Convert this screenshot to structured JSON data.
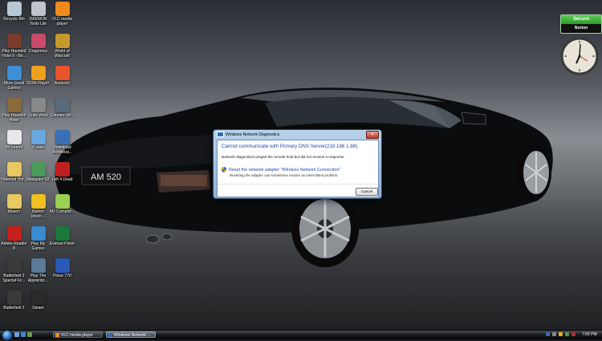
{
  "desktop": {
    "icons": [
      {
        "label": "Recycle Bin",
        "name": "recycle-bin-icon",
        "col": 0,
        "row": 0,
        "color": "#b8c7d6"
      },
      {
        "label": "DAEMON Tools Lite",
        "name": "daemon-tools-icon",
        "col": 1,
        "row": 0,
        "color": "#c0c4c8"
      },
      {
        "label": "VLC media player",
        "name": "vlc-icon",
        "col": 2,
        "row": 0,
        "color": "#f08a1c"
      },
      {
        "label": "Play Haunted Hotel II - Be...",
        "name": "haunted-hotel-2-icon",
        "col": 0,
        "row": 1,
        "color": "#7a3b2a"
      },
      {
        "label": "Dragonica",
        "name": "dragonica-icon",
        "col": 1,
        "row": 1,
        "color": "#c94a6a"
      },
      {
        "label": "World of Warcraft",
        "name": "wow-icon",
        "col": 2,
        "row": 1,
        "color": "#c49a2a"
      },
      {
        "label": "More Great Games",
        "name": "more-games-icon",
        "col": 0,
        "row": 2,
        "color": "#3d8fd6"
      },
      {
        "label": "GOM Player",
        "name": "gom-player-icon",
        "col": 1,
        "row": 2,
        "color": "#f0a020"
      },
      {
        "label": "Audacity",
        "name": "audacity-icon",
        "col": 2,
        "row": 2,
        "color": "#e8552a"
      },
      {
        "label": "Play Haunted Hotel",
        "name": "haunted-hotel-icon",
        "col": 0,
        "row": 3,
        "color": "#8a6a3a"
      },
      {
        "label": "Guild Wars",
        "name": "guild-wars-icon",
        "col": 1,
        "row": 3,
        "color": "#888888"
      },
      {
        "label": "Counter-Str...",
        "name": "counter-strike-icon",
        "col": 2,
        "row": 3,
        "color": "#5a6a7a"
      },
      {
        "label": "BitTorrent",
        "name": "bittorrent-icon",
        "col": 0,
        "row": 4,
        "color": "#e8e8e8"
      },
      {
        "label": "iTunes",
        "name": "itunes-icon",
        "col": 1,
        "row": 4,
        "color": "#6aa8e0"
      },
      {
        "label": "Download Accelerat...",
        "name": "download-accelerator-icon",
        "col": 2,
        "row": 4,
        "color": "#3a6fb8"
      },
      {
        "label": "Haunted Hot...",
        "name": "haunted-hotel-folder-icon",
        "col": 0,
        "row": 5,
        "color": "#e8c860"
      },
      {
        "label": "Navigator 52",
        "name": "navigator-icon",
        "col": 1,
        "row": 5,
        "color": "#4a9a5a"
      },
      {
        "label": "Left 4 Dead",
        "name": "left-4-dead-icon",
        "col": 2,
        "row": 5,
        "color": "#c02020"
      },
      {
        "label": "Mason",
        "name": "mason-folder-icon",
        "col": 0,
        "row": 6,
        "color": "#e8c860"
      },
      {
        "label": "Norton Intern...",
        "name": "norton-internet-icon",
        "col": 1,
        "row": 6,
        "color": "#f0c020"
      },
      {
        "label": "My Complet...",
        "name": "my-complete-folder-icon",
        "col": 2,
        "row": 6,
        "color": "#9ad050"
      },
      {
        "label": "Adobe Reader 8",
        "name": "adobe-reader-icon",
        "col": 0,
        "row": 7,
        "color": "#c8201a"
      },
      {
        "label": "Play My Games",
        "name": "play-my-games-icon",
        "col": 1,
        "row": 7,
        "color": "#3a8ad0"
      },
      {
        "label": "Everest Poker",
        "name": "everest-poker-icon",
        "col": 2,
        "row": 7,
        "color": "#1a7a3a"
      },
      {
        "label": "Battlefield 2 Special Fo...",
        "name": "battlefield-2-sf-icon",
        "col": 0,
        "row": 8,
        "color": "#3a3a3a"
      },
      {
        "label": "Play The Apprentic...",
        "name": "apprentice-icon",
        "col": 1,
        "row": 8,
        "color": "#5a7a9a"
      },
      {
        "label": "Poker 770",
        "name": "poker-770-icon",
        "col": 2,
        "row": 8,
        "color": "#2a5ab8"
      },
      {
        "label": "Battlefield 2",
        "name": "battlefield-2-icon",
        "col": 0,
        "row": 9,
        "color": "#3a3a3a"
      },
      {
        "label": "Steam",
        "name": "steam-icon",
        "col": 1,
        "row": 9,
        "color": "#2a2a2a"
      }
    ],
    "plate": "AM 520"
  },
  "norton": {
    "status": "Secure",
    "brand": "Norton"
  },
  "dialog": {
    "title": "Windows Network Diagnostics",
    "close": "×",
    "headline": "Cannot communicate with Primary DNS Server(218.186.1.88).",
    "detail": "Network diagnostics pinged the remote host but did not receive a response.",
    "option": "Reset the network adapter \"Wireless Network Connection\"",
    "option_desc": "Resetting the adapter can sometimes resolve an intermittent problem.",
    "cancel": "Cancel"
  },
  "taskbar": {
    "buttons": [
      {
        "label": "VLC media player",
        "color": "#f08a1c",
        "active": false
      },
      {
        "label": "Windows Network ...",
        "color": "#2c6fb8",
        "active": true
      }
    ],
    "time": "7:05 PM"
  }
}
